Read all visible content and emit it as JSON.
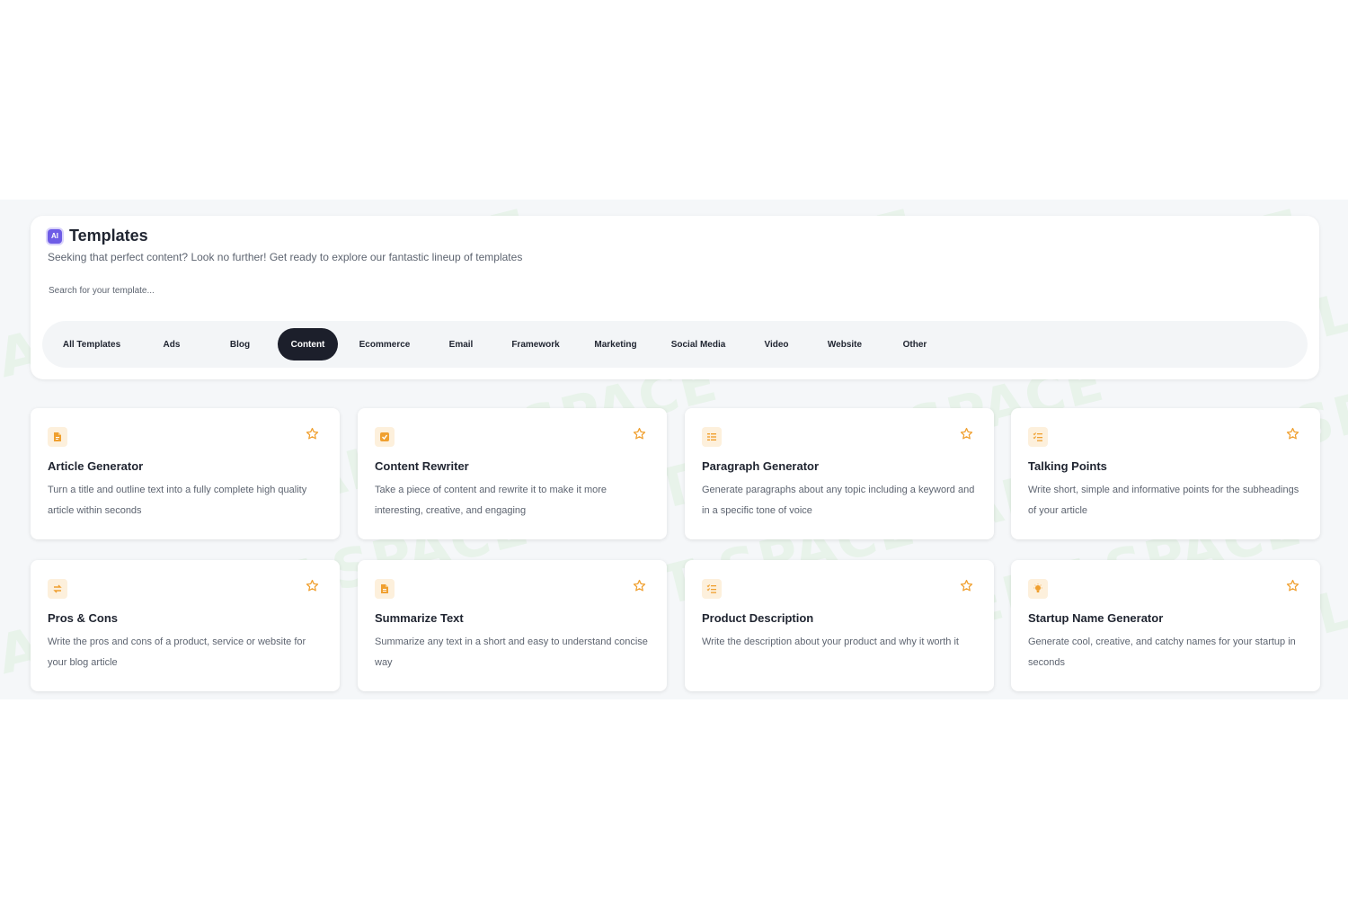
{
  "header": {
    "badge": "AI",
    "title": "Templates",
    "subtitle": "Seeking that perfect content? Look no further! Get ready to explore our fantastic lineup of templates",
    "search_placeholder": "Search for your template..."
  },
  "watermark_text": "AI TALENT SPACE",
  "tabs": [
    {
      "label": "All Templates",
      "active": false
    },
    {
      "label": "Ads",
      "active": false
    },
    {
      "label": "Blog",
      "active": false
    },
    {
      "label": "Content",
      "active": true
    },
    {
      "label": "Ecommerce",
      "active": false
    },
    {
      "label": "Email",
      "active": false
    },
    {
      "label": "Framework",
      "active": false
    },
    {
      "label": "Marketing",
      "active": false
    },
    {
      "label": "Social Media",
      "active": false
    },
    {
      "label": "Video",
      "active": false
    },
    {
      "label": "Website",
      "active": false
    },
    {
      "label": "Other",
      "active": false
    }
  ],
  "cards": [
    {
      "title": "Article Generator",
      "description": "Turn a title and outline text into a fully complete high quality article within seconds",
      "icon": "document-icon"
    },
    {
      "title": "Content Rewriter",
      "description": "Take a piece of content and rewrite it to make it more interesting, creative, and engaging",
      "icon": "check-square-icon"
    },
    {
      "title": "Paragraph Generator",
      "description": "Generate paragraphs about any topic including a keyword and in a specific tone of voice",
      "icon": "paragraph-icon"
    },
    {
      "title": "Talking Points",
      "description": "Write short, simple and informative points for the subheadings of your article",
      "icon": "checklist-icon"
    },
    {
      "title": "Pros & Cons",
      "description": "Write the pros and cons of a product, service or website for your blog article",
      "icon": "swap-icon"
    },
    {
      "title": "Summarize Text",
      "description": "Summarize any text in a short and easy to understand concise way",
      "icon": "file-text-icon"
    },
    {
      "title": "Product Description",
      "description": "Write the description about your product and why it worth it",
      "icon": "list-check-icon"
    },
    {
      "title": "Startup Name Generator",
      "description": "Generate cool, creative, and catchy names for your startup in seconds",
      "icon": "lightbulb-icon"
    }
  ],
  "colors": {
    "accent": "#f0a030",
    "icon_bg": "#fdf0dc",
    "active_tab": "#1c1f2b",
    "badge": "#6e5ce6"
  }
}
